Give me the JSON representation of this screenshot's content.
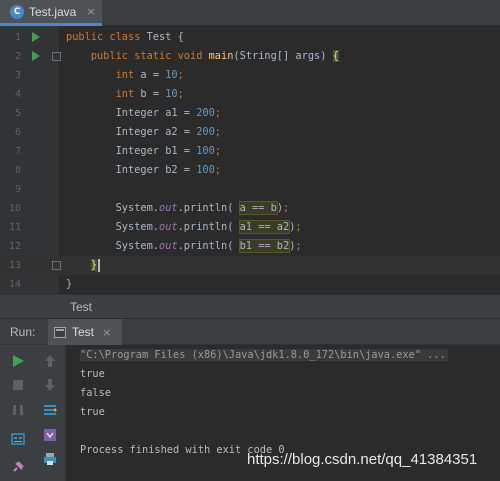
{
  "editor_tab": {
    "icon_letter": "C",
    "label": "Test.java",
    "close": "×"
  },
  "code_lines": [
    {
      "n": "1",
      "html": "<span class=\"kw\">public class</span> Test {"
    },
    {
      "n": "2",
      "html": "    <span class=\"kw\">public static void</span> <span class=\"fn\">main</span>(String[] args) <span class=\"brace-hl\">{</span>"
    },
    {
      "n": "3",
      "html": "        <span class=\"kw\">int</span> a = <span class=\"num\">10</span><span class=\"kw\">;</span>"
    },
    {
      "n": "4",
      "html": "        <span class=\"kw\">int</span> b = <span class=\"num\">10</span><span class=\"kw\">;</span>"
    },
    {
      "n": "5",
      "html": "        Integer a1 = <span class=\"num\">200</span><span class=\"kw\">;</span>"
    },
    {
      "n": "6",
      "html": "        Integer a2 = <span class=\"num\">200</span><span class=\"kw\">;</span>"
    },
    {
      "n": "7",
      "html": "        Integer b1 = <span class=\"num\">100</span><span class=\"kw\">;</span>"
    },
    {
      "n": "8",
      "html": "        Integer b2 = <span class=\"num\">100</span><span class=\"kw\">;</span>"
    },
    {
      "n": "9",
      "html": ""
    },
    {
      "n": "10",
      "html": "        System.<span class=\"fld\">out</span>.println( <span class=\"hl\">a == b</span>)<span class=\"kw\">;</span>"
    },
    {
      "n": "11",
      "html": "        System.<span class=\"fld\">out</span>.println( <span class=\"hl\">a1 == a2</span>)<span class=\"kw\">;</span>"
    },
    {
      "n": "12",
      "html": "        System.<span class=\"fld\">out</span>.println( <span class=\"hl\">b1 == b2</span>)<span class=\"kw\">;</span>"
    },
    {
      "n": "13",
      "html": "    <span class=\"brace-hl\">}</span><span class=\"caret\"></span>"
    },
    {
      "n": "14",
      "html": "}"
    }
  ],
  "run_lines": [
    1,
    2
  ],
  "fold_lines": [
    2,
    13
  ],
  "current_line": 13,
  "breadcrumb": "Test",
  "run_panel": {
    "title": "Run:",
    "tab_label": "Test",
    "close": "×",
    "console": [
      {
        "text": "\"C:\\Program Files (x86)\\Java\\jdk1.8.0_172\\bin\\java.exe\" ...",
        "cls": "cmd"
      },
      {
        "text": "true",
        "cls": ""
      },
      {
        "text": "false",
        "cls": ""
      },
      {
        "text": "true",
        "cls": ""
      },
      {
        "text": "",
        "cls": ""
      },
      {
        "text": "Process finished with exit code 0",
        "cls": ""
      }
    ]
  },
  "tools": [
    "rerun-icon",
    "up-arrow-icon",
    "stop-icon",
    "down-arrow-icon",
    "pause-icon",
    "soft-wrap-icon",
    "dump-threads-icon",
    "scroll-to-end-icon",
    "settings-icon",
    "print-icon",
    "pin-icon",
    "trash-icon"
  ],
  "watermark": "https://blog.csdn.net/qq_41384351",
  "colors": {
    "accent": "#4a88c7",
    "run_green": "#499c54",
    "keyword": "#cc7832",
    "number": "#6897bb",
    "method": "#ffc66d",
    "field": "#9876aa"
  }
}
